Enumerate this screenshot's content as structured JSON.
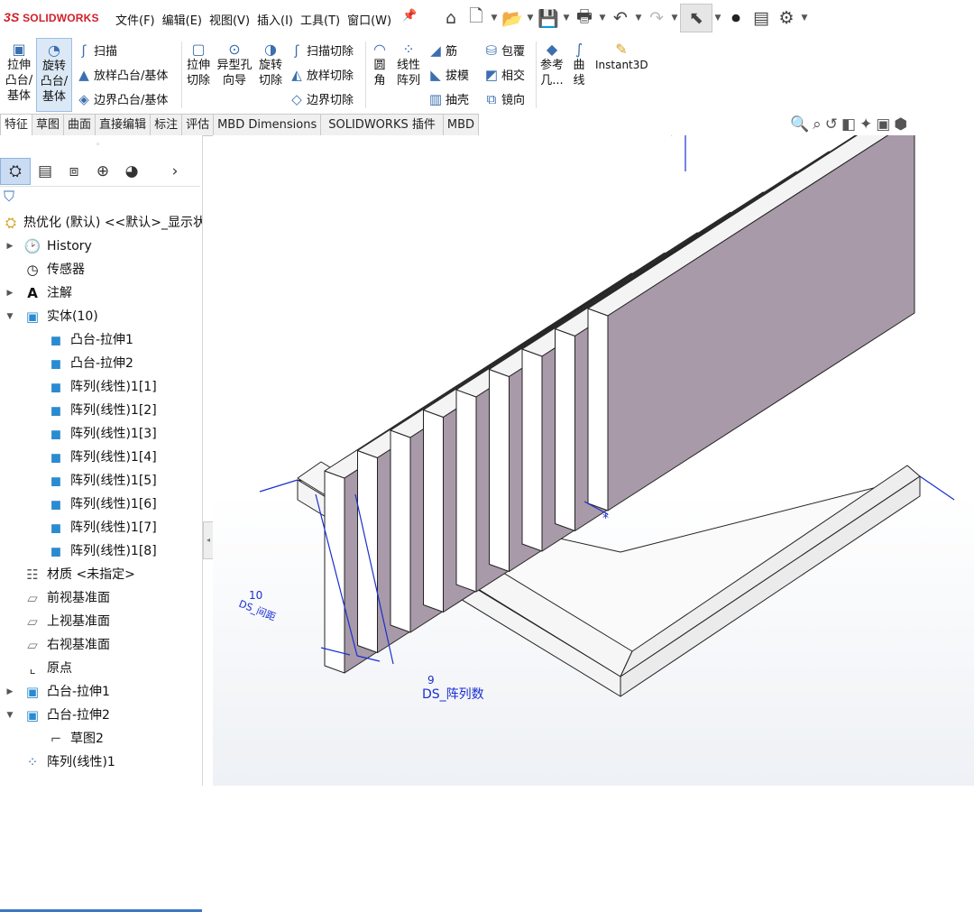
{
  "app": {
    "brand": "SOLIDWORKS",
    "brand_prefix": "3S"
  },
  "menu": [
    "文件(F)",
    "编辑(E)",
    "视图(V)",
    "插入(I)",
    "工具(T)",
    "窗口(W)"
  ],
  "quick_access": [
    "home-icon",
    "new-doc-icon",
    "open-icon",
    "save-icon",
    "print-icon",
    "undo-icon",
    "redo-icon",
    "select-arrow-icon",
    "traffic-light-icon",
    "file-properties-icon",
    "gear-icon"
  ],
  "ribbon": {
    "extrude_boss": "拉伸\n凸台/\n基体",
    "revolve_boss": "旋转\n凸台/\n基体",
    "sweep": "扫描",
    "loft_boss": "放样凸台/基体",
    "boundary_boss": "边界凸台/基体",
    "extrude_cut": "拉伸\n切除",
    "hole_wizard": "异型孔\n向导",
    "revolve_cut": "旋转\n切除",
    "swept_cut": "扫描切除",
    "lofted_cut": "放样切除",
    "boundary_cut": "边界切除",
    "fillet": "圆\n角",
    "linear_pattern": "线性\n阵列",
    "rib": "筋",
    "draft": "拔模",
    "shell": "抽壳",
    "wrap": "包覆",
    "intersect": "相交",
    "mirror": "镜向",
    "ref_geometry": "参考\n几...",
    "curves": "曲\n线",
    "instant3d": "Instant3D"
  },
  "tabs": [
    "特征",
    "草图",
    "曲面",
    "直接编辑",
    "标注",
    "评估",
    "MBD Dimensions",
    "SOLIDWORKS 插件",
    "MBD"
  ],
  "tree": {
    "root": "热优化 (默认) <<默认>_显示状",
    "history": "History",
    "sensors": "传感器",
    "annotations": "注解",
    "solid_bodies": "实体(10)",
    "bodies": [
      "凸台-拉伸1",
      "凸台-拉伸2",
      "阵列(线性)1[1]",
      "阵列(线性)1[2]",
      "阵列(线性)1[3]",
      "阵列(线性)1[4]",
      "阵列(线性)1[5]",
      "阵列(线性)1[6]",
      "阵列(线性)1[7]",
      "阵列(线性)1[8]"
    ],
    "material": "材质 <未指定>",
    "front_plane": "前视基准面",
    "top_plane": "上视基准面",
    "right_plane": "右视基准面",
    "origin": "原点",
    "boss_extrude1": "凸台-拉伸1",
    "boss_extrude2": "凸台-拉伸2",
    "sketch2": "草图2",
    "linear_pattern1": "阵列(线性)1"
  },
  "viewport": {
    "dim_spacing_value": "10",
    "dim_spacing_name": "DS_间距",
    "dim_count_value": "9",
    "dim_count_name": "DS_阵列数",
    "colors": {
      "fin_face": "#a89aa8",
      "fin_top": "#f4f4f4",
      "dim_line": "#1a2fd0"
    }
  }
}
